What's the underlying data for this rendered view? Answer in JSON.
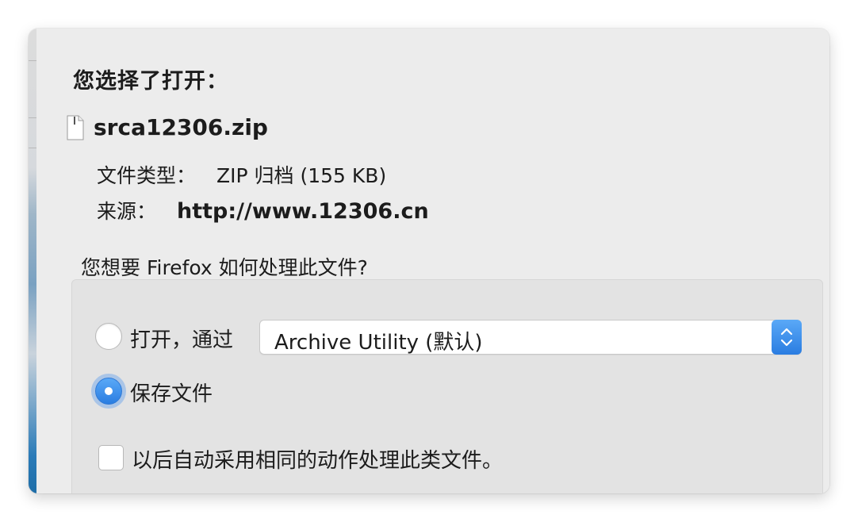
{
  "dialog": {
    "heading": "您选择了打开：",
    "file": {
      "icon": "document-icon",
      "name": "srca12306.zip"
    },
    "file_type": {
      "label": "文件类型：",
      "value": "ZIP 归档 (155 KB)"
    },
    "source": {
      "label": "来源：",
      "value": "http://www.12306.cn"
    },
    "question": "您想要 Firefox 如何处理此文件?",
    "options": {
      "open_with": {
        "label": "打开，通过",
        "selected": false,
        "app_value": "Archive Utility (默认)"
      },
      "save_file": {
        "label": "保存文件",
        "selected": true
      }
    },
    "remember_choice": {
      "label": "以后自动采用相同的动作处理此类文件。",
      "checked": false
    }
  },
  "colors": {
    "accent": "#2a7de1",
    "dialog_bg": "#ececec",
    "group_bg": "#e3e3e3"
  }
}
